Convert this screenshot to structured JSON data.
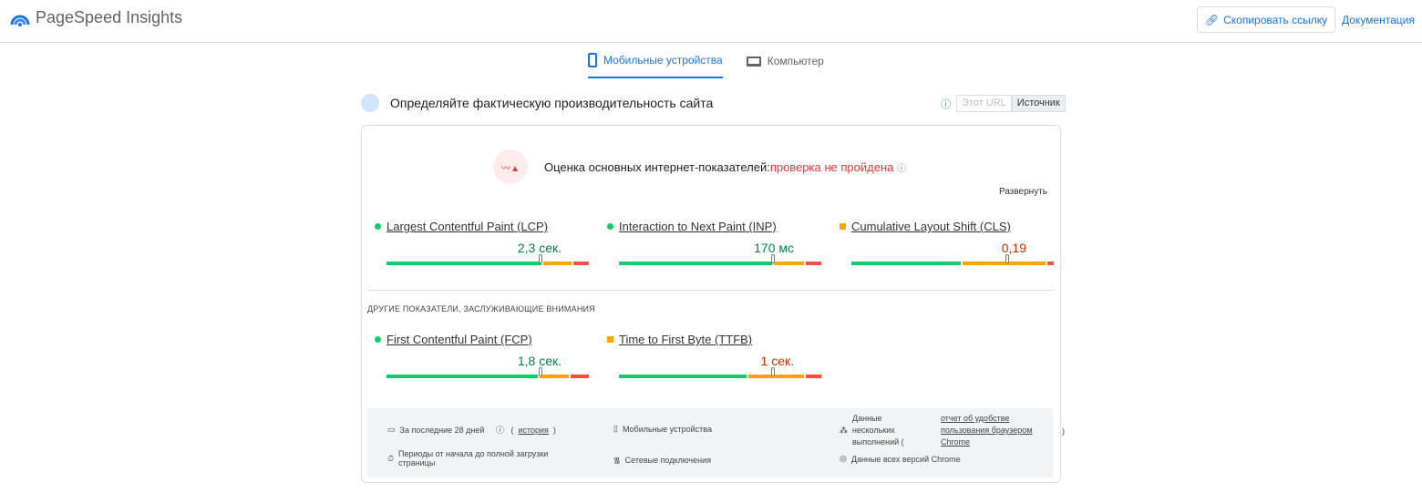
{
  "header": {
    "title": "PageSpeed Insights",
    "copy_link": "Скопировать ссылку",
    "docs": "Документация"
  },
  "tabs": [
    {
      "label": "Мобильные устройства",
      "active": true
    },
    {
      "label": "Компьютер",
      "active": false
    }
  ],
  "section": {
    "title": "Определяйте фактическую производительность сайта",
    "toggle_url": "Этот URL",
    "toggle_origin": "Источник"
  },
  "assessment": {
    "label": "Оценка основных интернет-показателей:",
    "status": "проверка не пройдена",
    "expand": "Развернуть"
  },
  "colors": {
    "good": "#0cce6b",
    "needs": "#ffa400",
    "poor": "#ff4e42",
    "good_text": "#018642",
    "needs_text": "#c33300"
  },
  "core_metrics": [
    {
      "name": "Largest Contentful Paint (LCP)",
      "value": "2,3 сек.",
      "rating": "good",
      "dist": [
        78,
        14,
        8
      ],
      "p75": 75
    },
    {
      "name": "Interaction to Next Paint (INP)",
      "value": "170 мс",
      "rating": "good",
      "dist": [
        77,
        15,
        8
      ],
      "p75": 75
    },
    {
      "name": "Cumulative Layout Shift (CLS)",
      "value": "0,19",
      "rating": "needs",
      "dist": [
        55,
        42,
        3
      ],
      "p75": 76
    }
  ],
  "other_title": "ДРУГИЕ ПОКАЗАТЕЛИ, ЗАСЛУЖИВАЮЩИЕ ВНИМАНИЯ",
  "other_metrics": [
    {
      "name": "First Contentful Paint (FCP)",
      "value": "1,8 сек.",
      "rating": "good",
      "dist": [
        76,
        15,
        9
      ],
      "p75": 75
    },
    {
      "name": "Time to First Byte (TTFB)",
      "value": "1 сек.",
      "rating": "needs",
      "dist": [
        64,
        28,
        8
      ],
      "p75": 75
    }
  ],
  "footer": {
    "period": "За последние 28 дней",
    "history": "история",
    "device": "Мобильные устройства",
    "samples_pre": "Данные нескольких выполнений (",
    "samples_link": "отчет об удобстве пользования браузером Chrome",
    "samples_post": ")",
    "duration": "Периоды от начала до полной загрузки страницы",
    "network": "Сетевые подключения",
    "versions": "Данные всех версий Chrome"
  }
}
